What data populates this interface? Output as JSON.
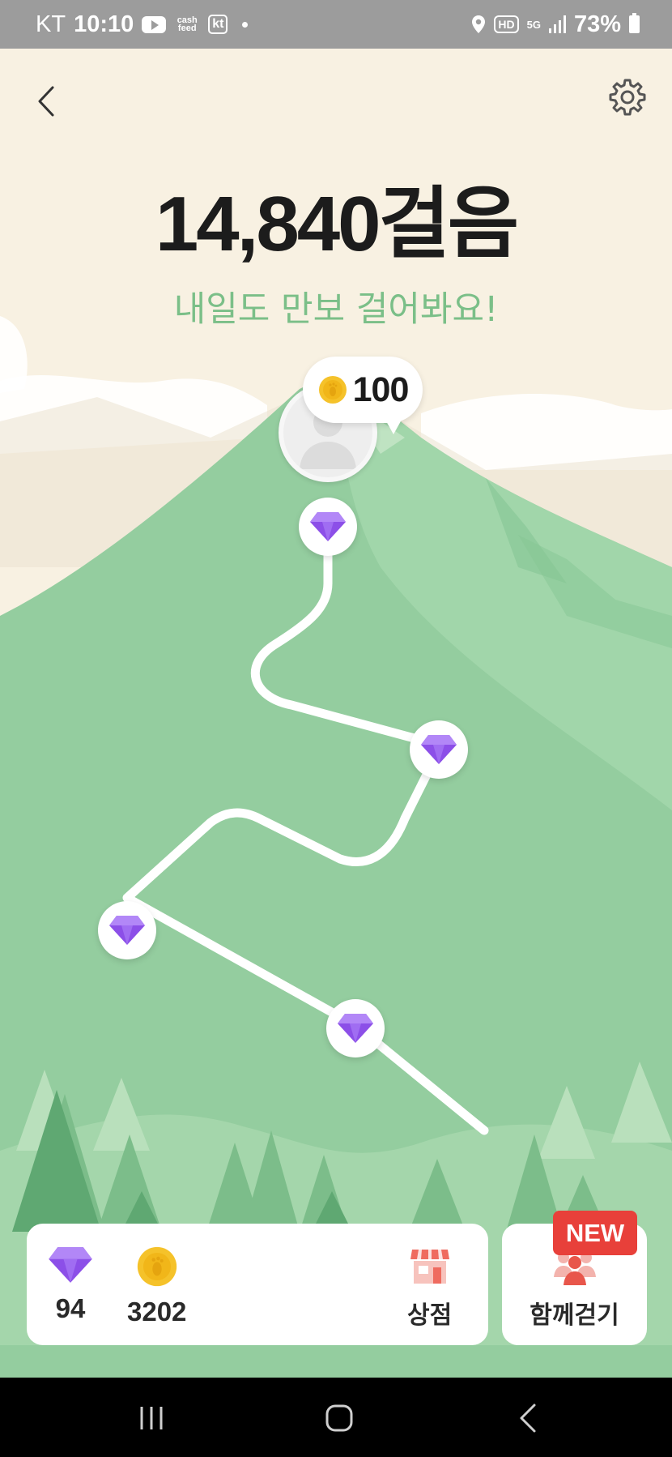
{
  "status_bar": {
    "carrier": "KT",
    "time": "10:10",
    "app_icons": [
      "youtube-icon",
      "cashfeed-icon",
      "kt-icon"
    ],
    "cashfeed_text": "cash feed",
    "kt_badge": "kt",
    "hd_badge": "HD",
    "network": "5G",
    "battery": "73%"
  },
  "header": {
    "back_icon": "chevron-left-icon",
    "settings_icon": "gear-icon"
  },
  "main": {
    "steps": "14,840걸음",
    "subtitle": "내일도 만보 걸어봐요!",
    "reward": "100",
    "reward_icon": "coin-icon",
    "path_nodes": [
      "diamond",
      "diamond",
      "diamond",
      "diamond"
    ]
  },
  "bottom": {
    "diamonds": "94",
    "coins": "3202",
    "shop_label": "상점",
    "together_label": "함께걷기",
    "new_badge": "NEW"
  },
  "nav": {
    "buttons": [
      "recent-apps",
      "home",
      "back"
    ]
  },
  "colors": {
    "sky": "#f8f1e2",
    "mountain": "#94cd9f",
    "accent_green": "#7bbf88",
    "diamond": "#8c4fe8",
    "coin": "#f5c22a",
    "badge_red": "#e8403a"
  }
}
